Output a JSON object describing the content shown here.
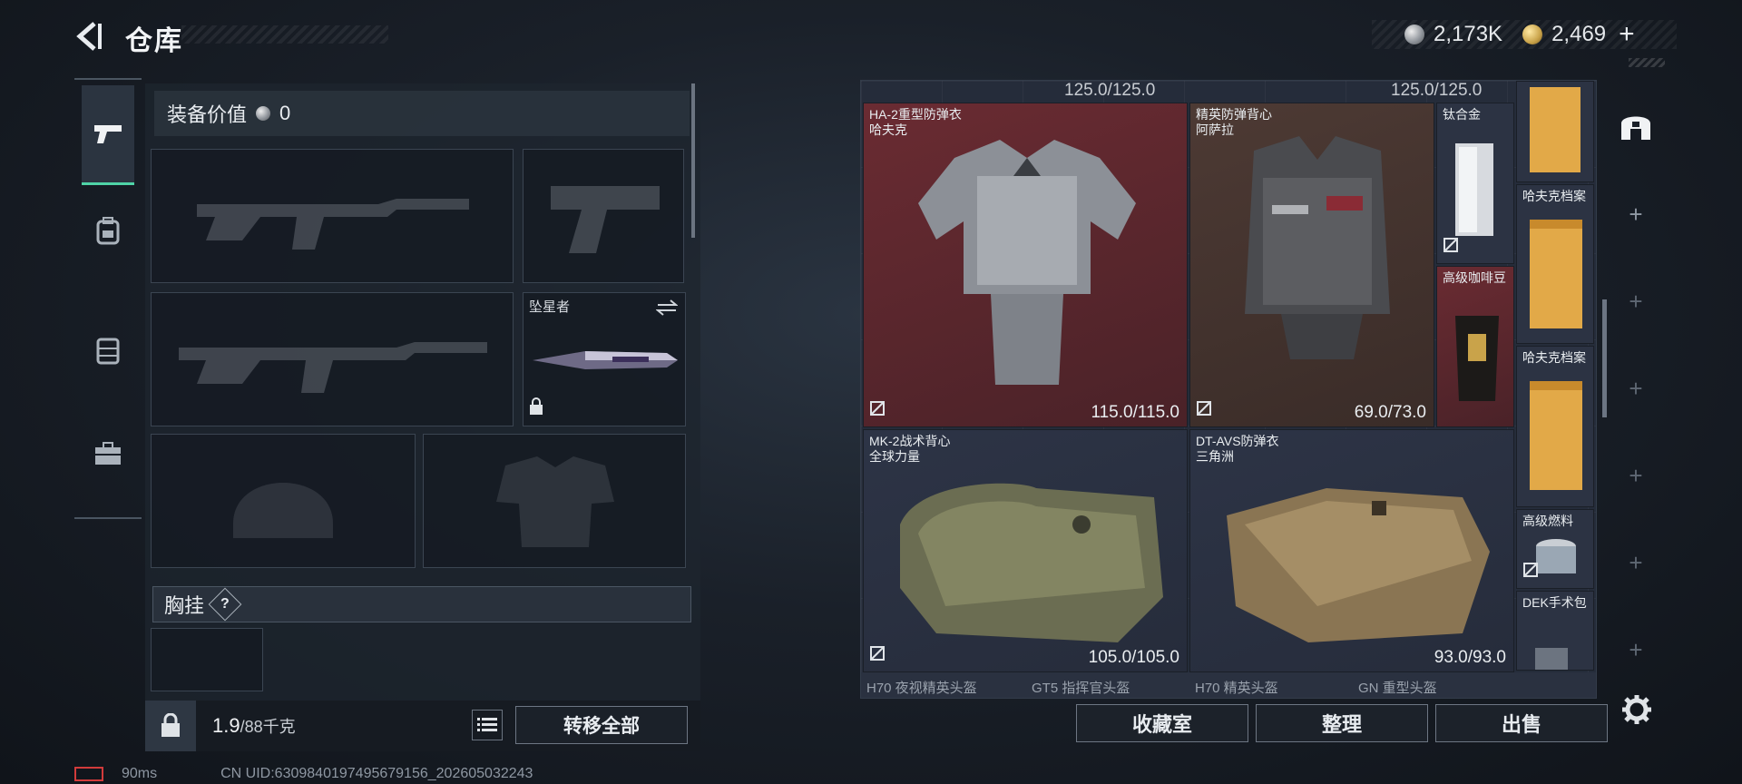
{
  "header": {
    "title": "仓库",
    "currency_silver": "2,173K",
    "currency_gold": "2,469",
    "add_label": "+"
  },
  "loadout": {
    "value_label": "装备价值",
    "value_amount": "0",
    "melee_slot_label": "坠星者",
    "chest_rig_label": "胸挂",
    "chest_rig_help": "?",
    "weight_value": "1.9",
    "weight_capacity": "/88千克",
    "transfer_all_label": "转移全部"
  },
  "status": {
    "ping": "90ms",
    "uid": "CN UID:6309840197495679156_202605032243"
  },
  "storage": {
    "top_values": [
      "125.0/125.0",
      "125.0/125.0"
    ],
    "items": [
      {
        "name": "HA-2重型防弹衣",
        "brand": "哈夫克",
        "durability": "115.0/115.0"
      },
      {
        "name": "精英防弹背心",
        "brand": "阿萨拉",
        "durability": "69.0/73.0"
      },
      {
        "name": "MK-2战术背心",
        "brand": "全球力量",
        "durability": "105.0/105.0"
      },
      {
        "name": "DT-AVS防弹衣",
        "brand": "三角洲",
        "durability": "93.0/93.0"
      }
    ],
    "side_items": [
      {
        "name": "钛合金"
      },
      {
        "name": "高级咖啡豆"
      },
      {
        "name": "哈夫克档案"
      },
      {
        "name": "哈夫克档案"
      },
      {
        "name": "高级燃料"
      },
      {
        "name": "DEK手术包"
      }
    ],
    "bottom_items": [
      "H70 夜视精英头盔",
      "GT5 指挥官头盔",
      "H70 精英头盔",
      "GN 重型头盔"
    ]
  },
  "actions": {
    "collection_label": "收藏室",
    "organize_label": "整理",
    "sell_label": "出售"
  },
  "rail": {
    "plus": "+"
  },
  "colors": {
    "accent": "#4fd3a7",
    "armor_red": "#6a2b32",
    "armor_brown": "#4d3a34",
    "armor_blue": "#2d3446"
  }
}
